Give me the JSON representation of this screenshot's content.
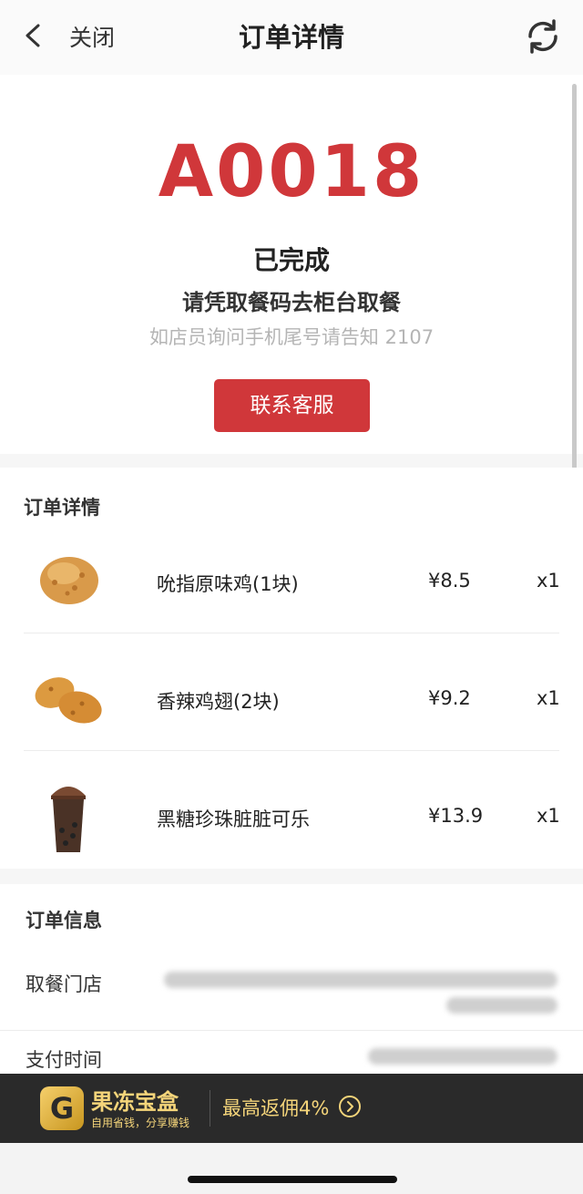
{
  "nav": {
    "close_label": "关闭",
    "title": "订单详情"
  },
  "pickup": {
    "code": "A0018",
    "status": "已完成",
    "instruction": "请凭取餐码去柜台取餐",
    "hint": "如店员询问手机尾号请告知 2107",
    "contact_button": "联系客服"
  },
  "order_details": {
    "title": "订单详情",
    "items": [
      {
        "name": "吮指原味鸡(1块)",
        "price": "¥8.5",
        "qty": "x1",
        "icon": "fried-chicken-icon"
      },
      {
        "name": "香辣鸡翅(2块)",
        "price": "¥9.2",
        "qty": "x1",
        "icon": "chicken-wings-icon"
      },
      {
        "name": "黑糖珍珠脏脏可乐",
        "price": "¥13.9",
        "qty": "x1",
        "icon": "drink-cup-icon"
      }
    ]
  },
  "order_info": {
    "title": "订单信息",
    "store_label": "取餐门店",
    "pay_time_label": "支付时间"
  },
  "banner": {
    "logo_letter": "G",
    "name": "果冻宝盒",
    "slogan": "自用省钱，分享赚钱",
    "rebate": "最高返佣4%"
  },
  "colors": {
    "accent": "#d0373a",
    "banner_bg": "#2a2a2a",
    "banner_text": "#f5d57a"
  }
}
